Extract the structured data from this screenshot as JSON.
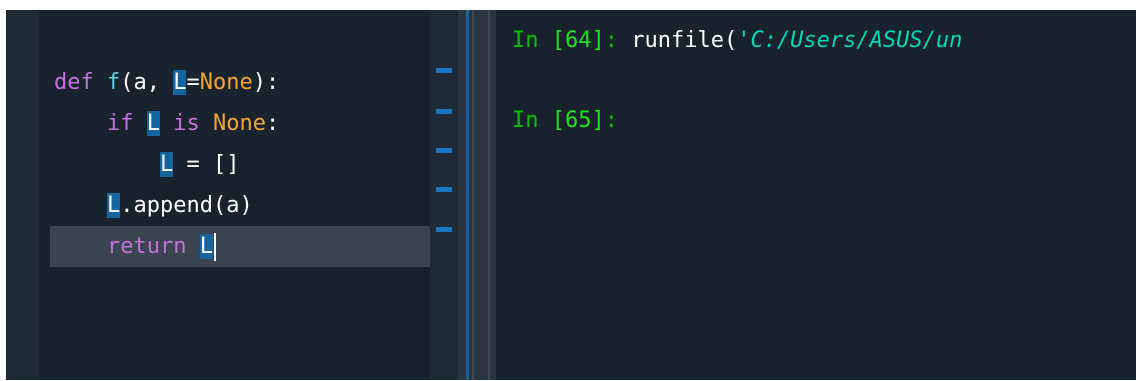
{
  "editor": {
    "lines": [
      {
        "t1": "def",
        "t2": " ",
        "t3": "f",
        "t4": "(a, ",
        "var": "L",
        "t5": "=",
        "t6": "None",
        "t7": "):"
      },
      {
        "indent": "    ",
        "kw": "if",
        "sp": " ",
        "var": "L",
        "sp2": " ",
        "kw2": "is",
        "sp3": " ",
        "con": "None",
        "end": ":"
      },
      {
        "indent": "        ",
        "var": "L",
        "rest": " = []"
      },
      {
        "indent": "    ",
        "var": "L",
        "rest": ".append(a)"
      },
      {
        "indent": "    ",
        "kw": "return",
        "sp": " ",
        "var": "L"
      }
    ]
  },
  "console": {
    "prompt1": {
      "in": "In ",
      "num": "[64]",
      "colon": ": ",
      "code": "runfile(",
      "string": "'C:/Users/ASUS/un"
    },
    "prompt2": {
      "in": "In ",
      "num": "[65]",
      "colon": ":"
    }
  }
}
